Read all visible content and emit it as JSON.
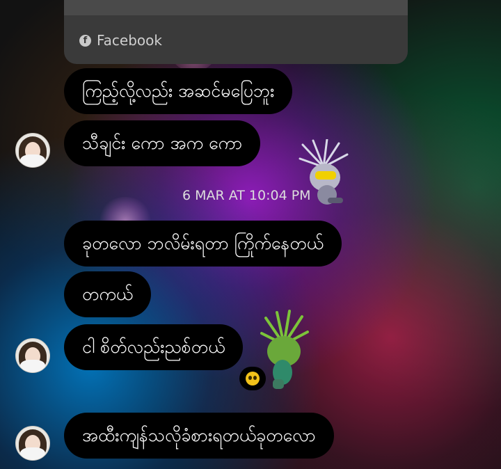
{
  "link_card": {
    "source_label": "Facebook",
    "icon": "facebook-icon"
  },
  "messages": [
    {
      "text": "ကြည့်လို့လည်း အဆင်မပြေဘူး"
    },
    {
      "text": "သီချင်း ကော အက ကော"
    },
    {
      "text": "ခုတလော ဘလိမ်းရတာ ကြိုက်နေတယ်"
    },
    {
      "text": "တကယ်"
    },
    {
      "text": "ငါ စိတ်လည်းညစ်တယ်"
    },
    {
      "text": "အထီးကျန်သလိုခံစားရတယ်ခုတလော"
    }
  ],
  "timestamp": "6 MAR AT 10:04 PM",
  "reaction": {
    "icon": "pleading-face-emoji"
  },
  "colors": {
    "bubble": "#000000",
    "text": "#ffffff",
    "card": "#3a3a3a"
  }
}
